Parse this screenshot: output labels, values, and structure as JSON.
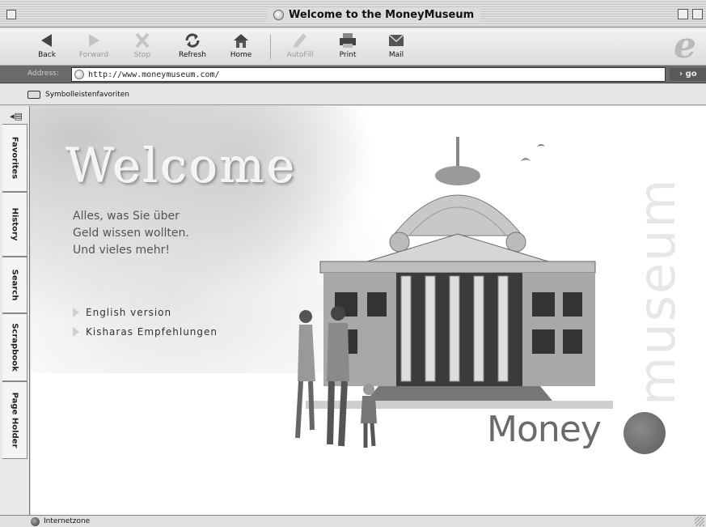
{
  "window": {
    "title": "Welcome to the MoneyMuseum"
  },
  "toolbar": {
    "buttons": [
      {
        "label": "Back",
        "icon": "back-arrow-icon",
        "enabled": true
      },
      {
        "label": "Forward",
        "icon": "forward-arrow-icon",
        "enabled": false
      },
      {
        "label": "Stop",
        "icon": "stop-x-icon",
        "enabled": false
      },
      {
        "label": "Refresh",
        "icon": "refresh-icon",
        "enabled": true
      },
      {
        "label": "Home",
        "icon": "home-icon",
        "enabled": true
      },
      {
        "label": "AutoFill",
        "icon": "autofill-pen-icon",
        "enabled": false
      },
      {
        "label": "Print",
        "icon": "printer-icon",
        "enabled": true
      },
      {
        "label": "Mail",
        "icon": "mail-icon",
        "enabled": true
      }
    ]
  },
  "address": {
    "label": "Address:",
    "url": "http://www.moneymuseum.com/",
    "go_label": "go"
  },
  "favorites_bar": {
    "label": "Symbolleistenfavoriten"
  },
  "sidebar": {
    "tabs": [
      "Favorites",
      "History",
      "Search",
      "Scrapbook",
      "Page Holder"
    ]
  },
  "page": {
    "welcome": "Welcome",
    "tagline": [
      "Alles, was Sie über",
      "Geld wissen wollten.",
      "Und vieles mehr!"
    ],
    "links": [
      "English version",
      "Kisharas Empfehlungen"
    ],
    "logo_word": "Money",
    "vertical_word": "museum"
  },
  "status": {
    "text": "Internetzone"
  },
  "colors": {
    "address_bar": "#6a6a6a",
    "logo_gray": "#6b6b6b"
  }
}
